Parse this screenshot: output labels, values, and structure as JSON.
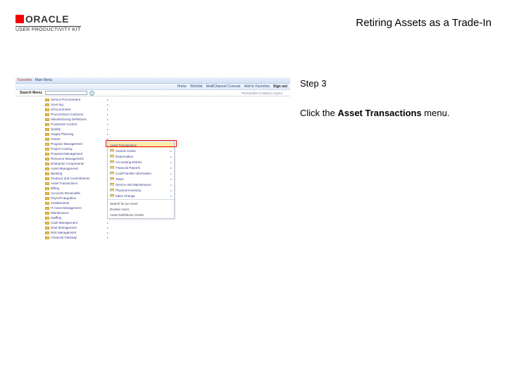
{
  "brand": {
    "oracle": "ORACLE",
    "upk": "USER PRODUCTIVITY KIT"
  },
  "title": "Retiring Assets as a Trade-In",
  "instr": {
    "step": "Step 3",
    "lead": "Click the ",
    "bold": "Asset Transactions",
    "tail": " menu."
  },
  "shot": {
    "crumb": "Favorites",
    "mm": "Main Menu",
    "nav": [
      "Home",
      "Worklist",
      "MultiChannel Console",
      "Add to Favorites",
      "Sign out"
    ],
    "searchLabel": "Search Menu:",
    "person": "Personalize Content | Layout",
    "menu": [
      "Service Procurement",
      "Sourcing",
      "eProcurement",
      "Procurement Contracts",
      "Manufacturing Definitions",
      "Production Control",
      "Quality",
      "Supply Planning",
      "Grants",
      "Program Management",
      "Project Costing",
      "Proposal Management",
      "Resource Management",
      "Enterprise Components",
      "Asset Management",
      "Banking",
      "Treasury and Commitments",
      "Asset Transactions",
      "Billing",
      "Accounts Receivable",
      "Payroll Integration",
      "eSettlements",
      "IT Asset Management",
      "Maintenance",
      "Staffing",
      "Cash Management",
      "Deal Management",
      "Risk Management",
      "Financial Gateway"
    ],
    "submenu": [
      "Asset Transactions",
      "Owned Assets",
      "Depreciation",
      "Accounting Entries",
      "Financial Reports",
      "Cost/Transfer Information",
      "Taxes",
      "Service and Maintenance",
      "Physical Inventory",
      "Mass Change",
      "Search for an Asset",
      "Review Asset",
      "Asset Definitions Center"
    ]
  }
}
